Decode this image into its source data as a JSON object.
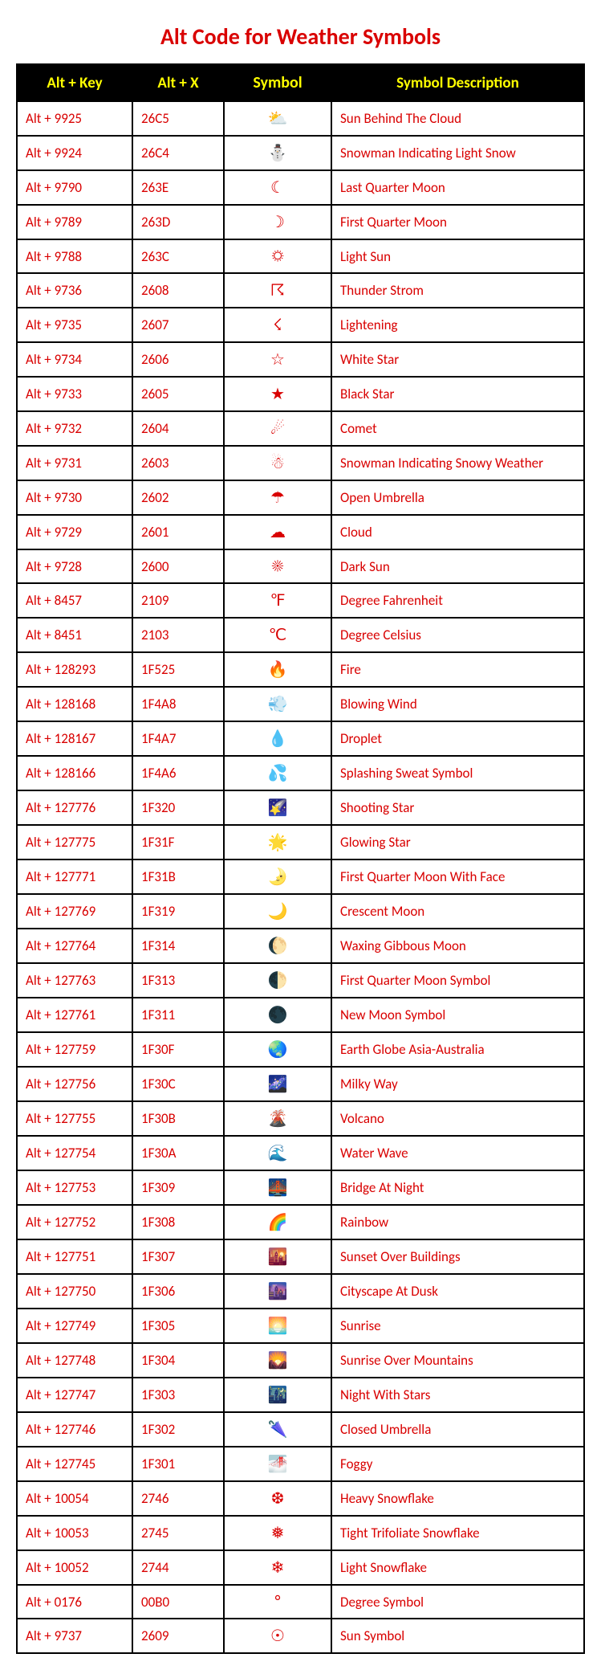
{
  "title": "Alt Code for Weather Symbols",
  "headers": [
    "Alt + Key",
    "Alt + X",
    "Symbol",
    "Symbol Description"
  ],
  "rows": [
    {
      "altkey": "Alt + 9925",
      "altx": "26C5",
      "symbol": "⛅",
      "desc": "Sun Behind The Cloud"
    },
    {
      "altkey": "Alt + 9924",
      "altx": "26C4",
      "symbol": "⛄",
      "desc": "Snowman Indicating Light Snow"
    },
    {
      "altkey": "Alt + 9790",
      "altx": "263E",
      "symbol": "☾",
      "desc": "Last Quarter Moon"
    },
    {
      "altkey": "Alt + 9789",
      "altx": "263D",
      "symbol": "☽",
      "desc": "First Quarter Moon"
    },
    {
      "altkey": "Alt + 9788",
      "altx": "263C",
      "symbol": "☼",
      "desc": "Light Sun"
    },
    {
      "altkey": "Alt + 9736",
      "altx": "2608",
      "symbol": "☈",
      "desc": "Thunder Strom"
    },
    {
      "altkey": "Alt + 9735",
      "altx": "2607",
      "symbol": "☇",
      "desc": "Lightening"
    },
    {
      "altkey": "Alt + 9734",
      "altx": "2606",
      "symbol": "☆",
      "desc": "White Star"
    },
    {
      "altkey": "Alt + 9733",
      "altx": "2605",
      "symbol": "★",
      "desc": "Black Star"
    },
    {
      "altkey": "Alt + 9732",
      "altx": "2604",
      "symbol": "☄",
      "desc": "Comet"
    },
    {
      "altkey": "Alt + 9731",
      "altx": "2603",
      "symbol": "☃",
      "desc": "Snowman Indicating Snowy Weather"
    },
    {
      "altkey": "Alt + 9730",
      "altx": "2602",
      "symbol": "☂",
      "desc": "Open Umbrella"
    },
    {
      "altkey": "Alt + 9729",
      "altx": "2601",
      "symbol": "☁",
      "desc": "Cloud"
    },
    {
      "altkey": "Alt + 9728",
      "altx": "2600",
      "symbol": "☀",
      "desc": "Dark Sun"
    },
    {
      "altkey": "Alt + 8457",
      "altx": "2109",
      "symbol": "℉",
      "desc": "Degree Fahrenheit"
    },
    {
      "altkey": "Alt + 8451",
      "altx": "2103",
      "symbol": "℃",
      "desc": "Degree Celsius"
    },
    {
      "altkey": "Alt + 128293",
      "altx": "1F525",
      "symbol": "🔥",
      "desc": "Fire"
    },
    {
      "altkey": "Alt + 128168",
      "altx": "1F4A8",
      "symbol": "💨",
      "desc": "Blowing Wind"
    },
    {
      "altkey": "Alt + 128167",
      "altx": "1F4A7",
      "symbol": "💧",
      "desc": "Droplet"
    },
    {
      "altkey": "Alt + 128166",
      "altx": "1F4A6",
      "symbol": "💦",
      "desc": "Splashing Sweat Symbol"
    },
    {
      "altkey": "Alt + 127776",
      "altx": "1F320",
      "symbol": "🌠",
      "desc": "Shooting Star"
    },
    {
      "altkey": "Alt + 127775",
      "altx": "1F31F",
      "symbol": "🌟",
      "desc": "Glowing Star"
    },
    {
      "altkey": "Alt + 127771",
      "altx": "1F31B",
      "symbol": "🌛",
      "desc": "First Quarter Moon With Face"
    },
    {
      "altkey": "Alt + 127769",
      "altx": "1F319",
      "symbol": "🌙",
      "desc": "Crescent Moon"
    },
    {
      "altkey": "Alt + 127764",
      "altx": "1F314",
      "symbol": "🌔",
      "desc": "Waxing Gibbous Moon"
    },
    {
      "altkey": "Alt + 127763",
      "altx": "1F313",
      "symbol": "🌓",
      "desc": "First Quarter Moon Symbol"
    },
    {
      "altkey": "Alt + 127761",
      "altx": "1F311",
      "symbol": "🌑",
      "desc": "New Moon Symbol"
    },
    {
      "altkey": "Alt + 127759",
      "altx": "1F30F",
      "symbol": "🌏",
      "desc": "Earth Globe Asia-Australia"
    },
    {
      "altkey": "Alt + 127756",
      "altx": "1F30C",
      "symbol": "🌌",
      "desc": "Milky Way"
    },
    {
      "altkey": "Alt + 127755",
      "altx": "1F30B",
      "symbol": "🌋",
      "desc": "Volcano"
    },
    {
      "altkey": "Alt + 127754",
      "altx": "1F30A",
      "symbol": "🌊",
      "desc": "Water Wave"
    },
    {
      "altkey": "Alt + 127753",
      "altx": "1F309",
      "symbol": "🌉",
      "desc": "Bridge At Night"
    },
    {
      "altkey": "Alt + 127752",
      "altx": "1F308",
      "symbol": "🌈",
      "desc": "Rainbow"
    },
    {
      "altkey": "Alt + 127751",
      "altx": "1F307",
      "symbol": "🌇",
      "desc": "Sunset Over Buildings"
    },
    {
      "altkey": "Alt + 127750",
      "altx": "1F306",
      "symbol": "🌆",
      "desc": "Cityscape At Dusk"
    },
    {
      "altkey": "Alt + 127749",
      "altx": "1F305",
      "symbol": "🌅",
      "desc": "Sunrise"
    },
    {
      "altkey": "Alt + 127748",
      "altx": "1F304",
      "symbol": "🌄",
      "desc": "Sunrise Over Mountains"
    },
    {
      "altkey": "Alt + 127747",
      "altx": "1F303",
      "symbol": "🌃",
      "desc": "Night With Stars"
    },
    {
      "altkey": "Alt + 127746",
      "altx": "1F302",
      "symbol": "🌂",
      "desc": "Closed Umbrella"
    },
    {
      "altkey": "Alt + 127745",
      "altx": "1F301",
      "symbol": "🌁",
      "desc": "Foggy"
    },
    {
      "altkey": "Alt + 10054",
      "altx": "2746",
      "symbol": "❆",
      "desc": "Heavy Snowflake"
    },
    {
      "altkey": "Alt + 10053",
      "altx": "2745",
      "symbol": "❅",
      "desc": "Tight Trifoliate Snowflake"
    },
    {
      "altkey": "Alt + 10052",
      "altx": "2744",
      "symbol": "❄",
      "desc": "Light Snowflake"
    },
    {
      "altkey": "Alt + 0176",
      "altx": "00B0",
      "symbol": "°",
      "desc": "Degree Symbol"
    },
    {
      "altkey": "Alt + 9737",
      "altx": "2609",
      "symbol": "☉",
      "desc": "Sun Symbol"
    }
  ]
}
